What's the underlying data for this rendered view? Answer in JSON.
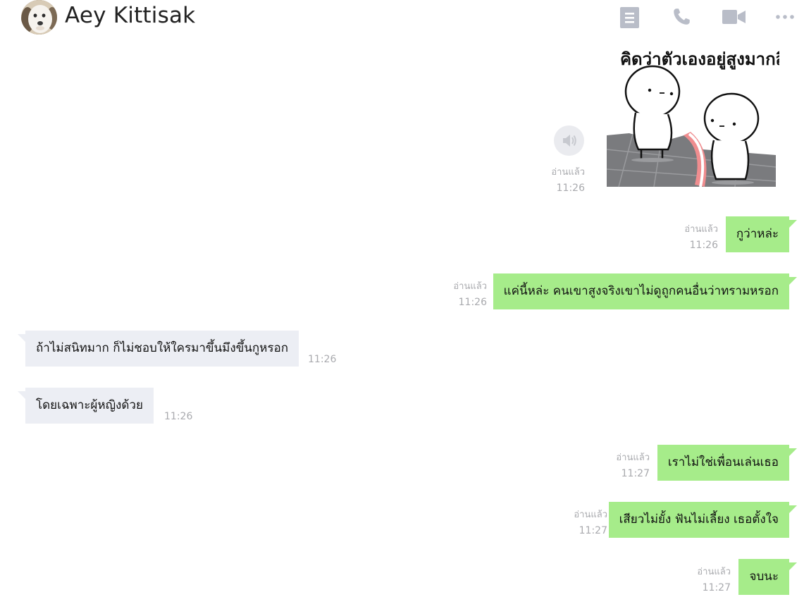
{
  "header": {
    "contact_name": "Aey Kittisak",
    "icons": [
      "notes-icon",
      "phone-icon",
      "video-icon",
      "more-icon"
    ]
  },
  "sticker": {
    "caption": "คิดว่าตัวเองอยู่สูงมากสินะ",
    "read_status": "อ่านแล้ว",
    "time": "11:26"
  },
  "messages": [
    {
      "direction": "out",
      "text": "กูว่าหล่ะ",
      "read_status": "อ่านแล้ว",
      "time": "11:26"
    },
    {
      "direction": "out",
      "text": "แค่นี้หล่ะ คนเขาสูงจริงเขาไม่ดูถูกคนอื่นว่าทรามหรอก",
      "read_status": "อ่านแล้ว",
      "time": "11:26"
    },
    {
      "direction": "in",
      "text": "ถ้าไม่สนิทมาก ก็ไม่ชอบให้ใครมาขึ้นมึงขึ้นกูหรอก",
      "time": "11:26"
    },
    {
      "direction": "in",
      "text": "โดยเฉพาะผู้หญิงด้วย",
      "time": "11:26"
    },
    {
      "direction": "out",
      "text": "เราไม่ใช่เพื่อนเล่นเธอ",
      "read_status": "อ่านแล้ว",
      "time": "11:27"
    },
    {
      "direction": "out",
      "text": "เสียวไม่ยั้ง ฟันไม่เลี้ยง เธอตั้งใจ",
      "read_status": "อ่านแล้ว",
      "time": "11:27"
    },
    {
      "direction": "out",
      "text": "จบนะ",
      "read_status": "อ่านแล้ว",
      "time": "11:27"
    }
  ],
  "colors": {
    "outgoing_bubble": "#a6ec8a",
    "incoming_bubble": "#eceef4",
    "meta_text": "#a9aaae",
    "header_icon": "#b9bdc8"
  }
}
